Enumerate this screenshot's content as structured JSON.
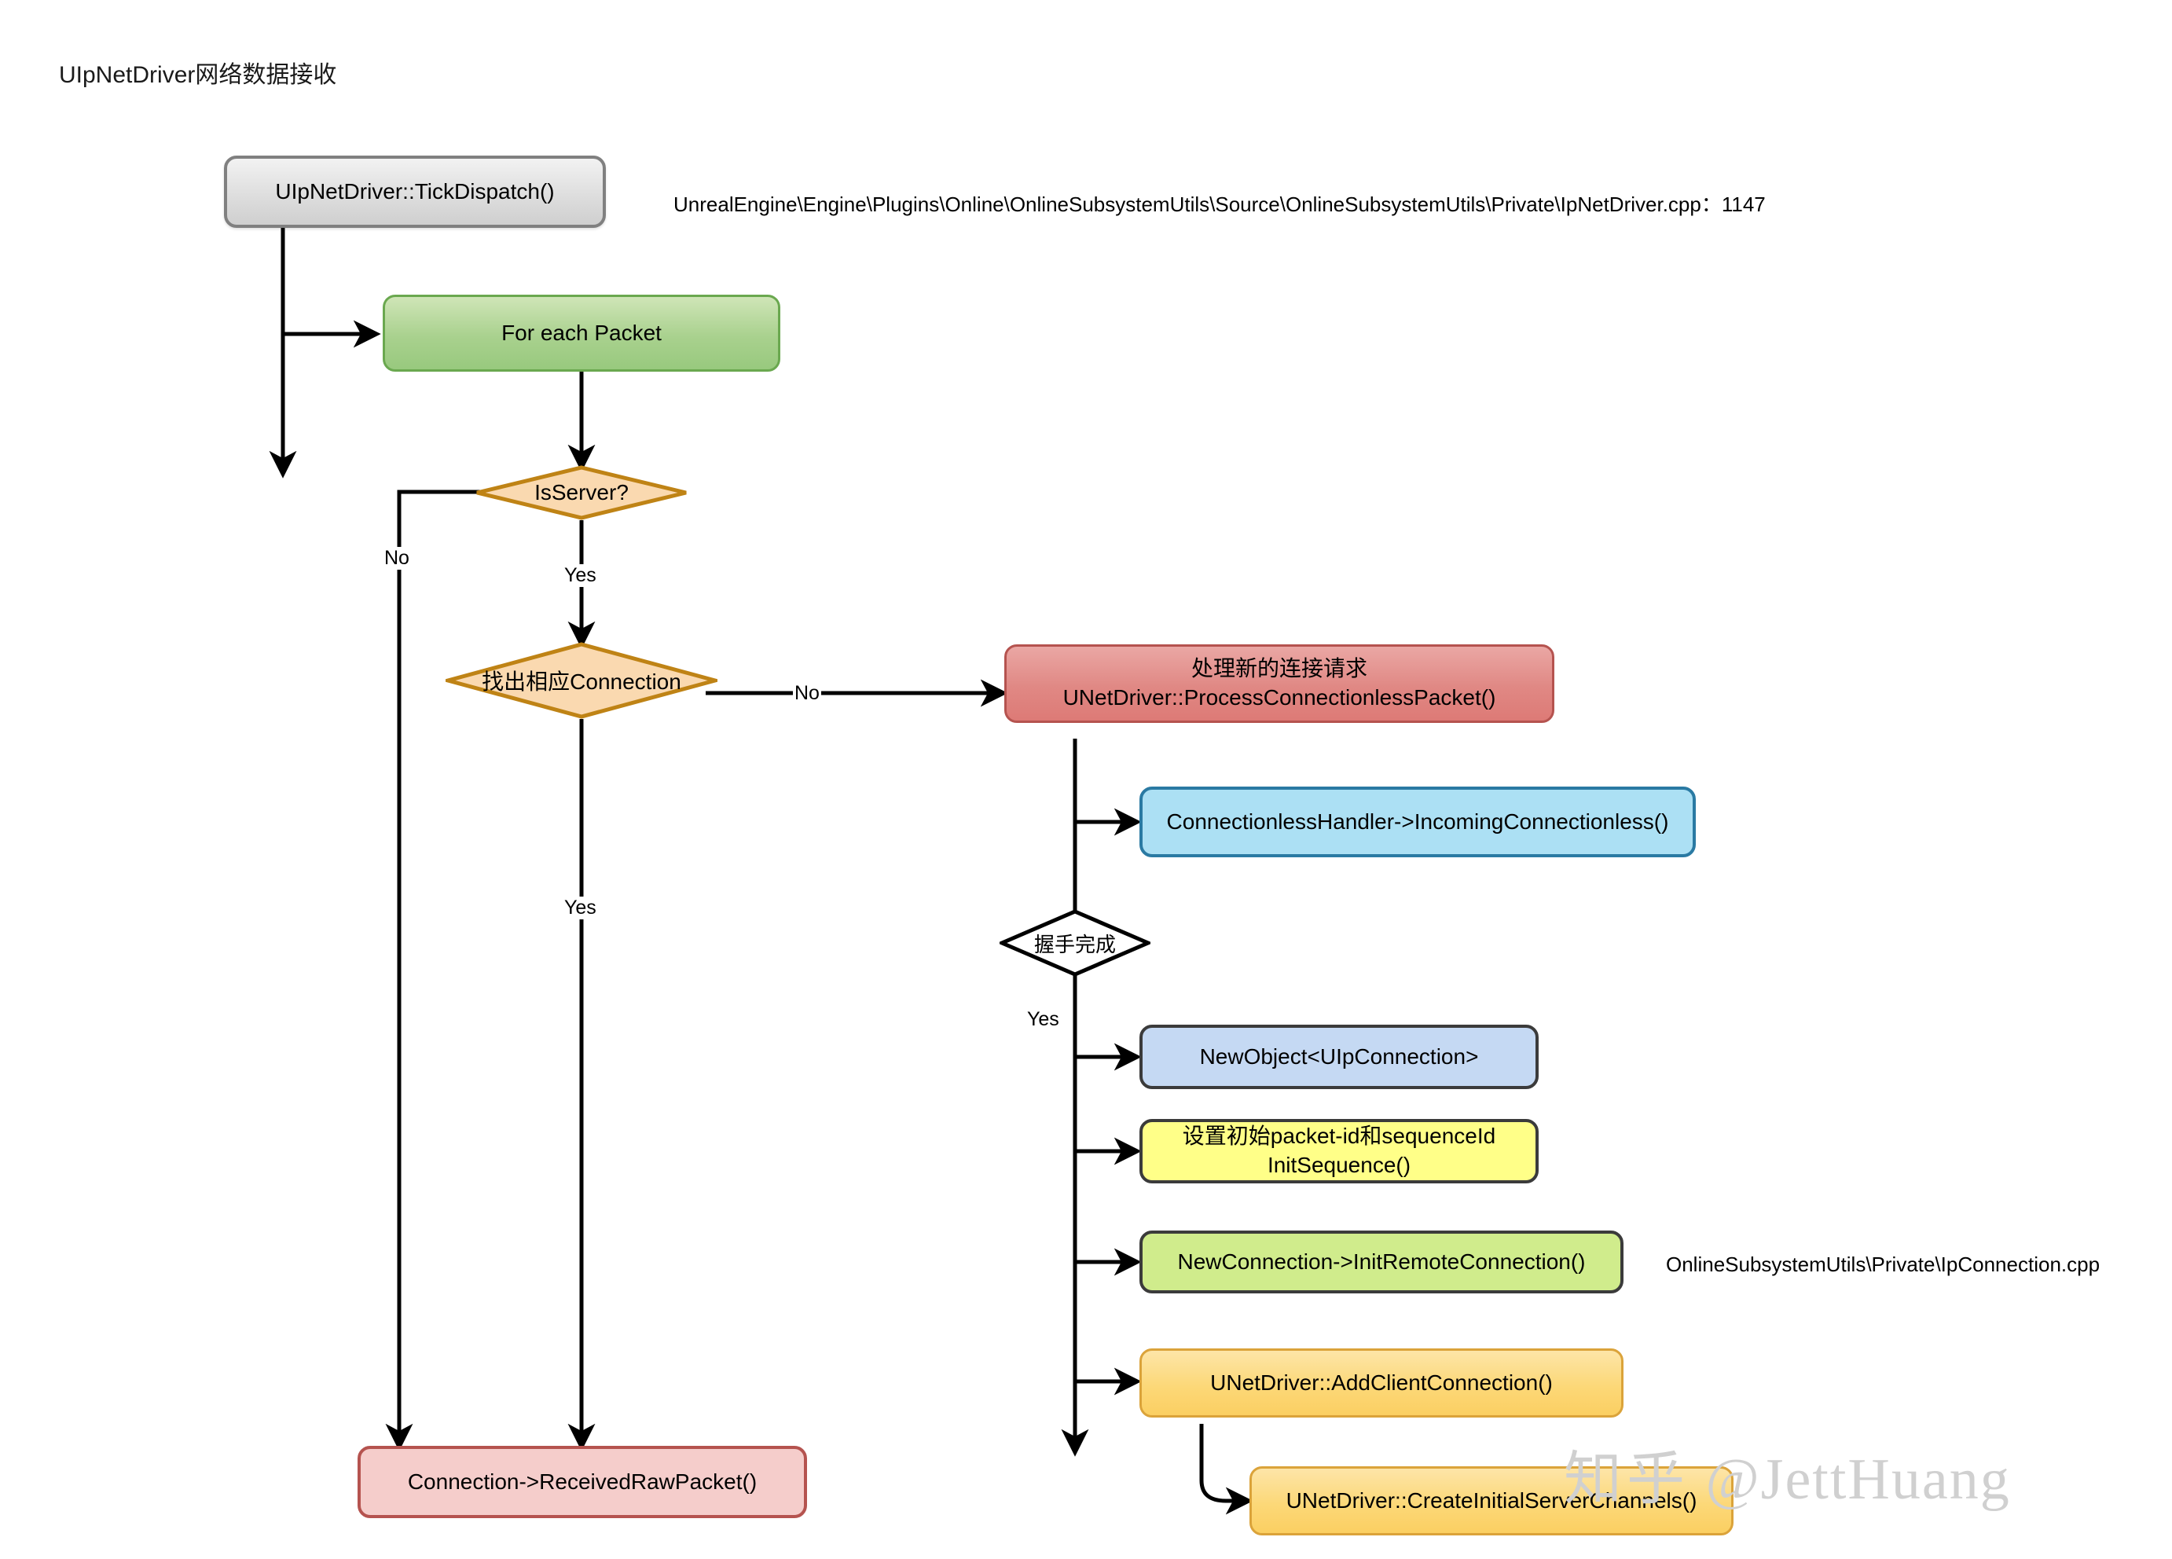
{
  "title": "UIpNetDriver网络数据接收",
  "watermark": {
    "logo": "知乎",
    "handle": "@JettHuang"
  },
  "annotations": [
    {
      "id": "ipnetdriver-path",
      "text": "UnrealEngine\\Engine\\Plugins\\Online\\OnlineSubsystemUtils\\Source\\OnlineSubsystemUtils\\Private\\IpNetDriver.cpp：1147"
    },
    {
      "id": "ipconnection-path",
      "text": "OnlineSubsystemUtils\\Private\\IpConnection.cpp"
    }
  ],
  "nodes": {
    "tick_dispatch": {
      "label": "UIpNetDriver::TickDispatch()",
      "shape": "rounded-rect",
      "fill": "#dedede",
      "stroke": "#808080"
    },
    "for_each_packet": {
      "label": "For each Packet",
      "shape": "rounded-rect",
      "fill": "#a9d18e",
      "stroke": "#6aa84f"
    },
    "is_server": {
      "label": "IsServer?",
      "shape": "diamond",
      "fill": "#fad9b0",
      "stroke": "#bf8315"
    },
    "find_connection": {
      "label": "找出相应Connection",
      "shape": "diamond",
      "fill": "#fad9b0",
      "stroke": "#bf8315"
    },
    "process_connectionless": {
      "label": "处理新的连接请求\nUNetDriver::ProcessConnectionlessPacket()",
      "shape": "rounded-rect",
      "fill": "#e08884",
      "stroke": "#b5534f"
    },
    "incoming_connectionless": {
      "label": "ConnectionlessHandler->IncomingConnectionless()",
      "shape": "rounded-rect",
      "fill": "#ace0f4",
      "stroke": "#2a7aa3"
    },
    "handshake_done": {
      "label": "握手完成",
      "shape": "diamond",
      "fill": "#ffffff",
      "stroke": "#000000"
    },
    "new_object": {
      "label": "NewObject<UIpConnection>",
      "shape": "rounded-rect",
      "fill": "#c5d9f3",
      "stroke": "#3b3b3b"
    },
    "init_sequence": {
      "label": "设置初始packet-id和sequenceId\nInitSequence()",
      "shape": "rounded-rect",
      "fill": "#ffff88",
      "stroke": "#3b3b3b"
    },
    "init_remote_connection": {
      "label": "NewConnection->InitRemoteConnection()",
      "shape": "rounded-rect",
      "fill": "#d0ec8c",
      "stroke": "#3b3b3b"
    },
    "add_client_connection": {
      "label": "UNetDriver::AddClientConnection()",
      "shape": "rounded-rect",
      "fill": "#fcd878",
      "stroke": "#dba33a"
    },
    "create_initial_server_channels": {
      "label": "UNetDriver::CreateInitialServerChannels()",
      "shape": "rounded-rect",
      "fill": "#fcd878",
      "stroke": "#dba33a"
    },
    "received_raw_packet": {
      "label": "Connection->ReceivedRawPacket()",
      "shape": "rounded-rect",
      "fill": "#f5cdcb",
      "stroke": "#b5534f"
    }
  },
  "edge_labels": {
    "is_server_no": "No",
    "is_server_yes": "Yes",
    "find_connection_no": "No",
    "find_connection_yes": "Yes",
    "handshake_yes": "Yes"
  },
  "edges": [
    {
      "from": "tick_dispatch",
      "to": "for_each_packet",
      "label": ""
    },
    {
      "from": "tick_dispatch",
      "to": "is_server",
      "label": ""
    },
    {
      "from": "for_each_packet",
      "to": "is_server",
      "label": ""
    },
    {
      "from": "is_server",
      "to": "received_raw_packet",
      "label": "No"
    },
    {
      "from": "is_server",
      "to": "find_connection",
      "label": "Yes"
    },
    {
      "from": "find_connection",
      "to": "process_connectionless",
      "label": "No"
    },
    {
      "from": "find_connection",
      "to": "received_raw_packet",
      "label": "Yes"
    },
    {
      "from": "process_connectionless",
      "to": "incoming_connectionless",
      "label": ""
    },
    {
      "from": "process_connectionless",
      "to": "handshake_done",
      "label": ""
    },
    {
      "from": "handshake_done",
      "to": "new_object",
      "label": "Yes"
    },
    {
      "from": "handshake_done",
      "to": "init_sequence",
      "label": ""
    },
    {
      "from": "handshake_done",
      "to": "init_remote_connection",
      "label": ""
    },
    {
      "from": "handshake_done",
      "to": "add_client_connection",
      "label": ""
    },
    {
      "from": "add_client_connection",
      "to": "create_initial_server_channels",
      "label": ""
    }
  ]
}
